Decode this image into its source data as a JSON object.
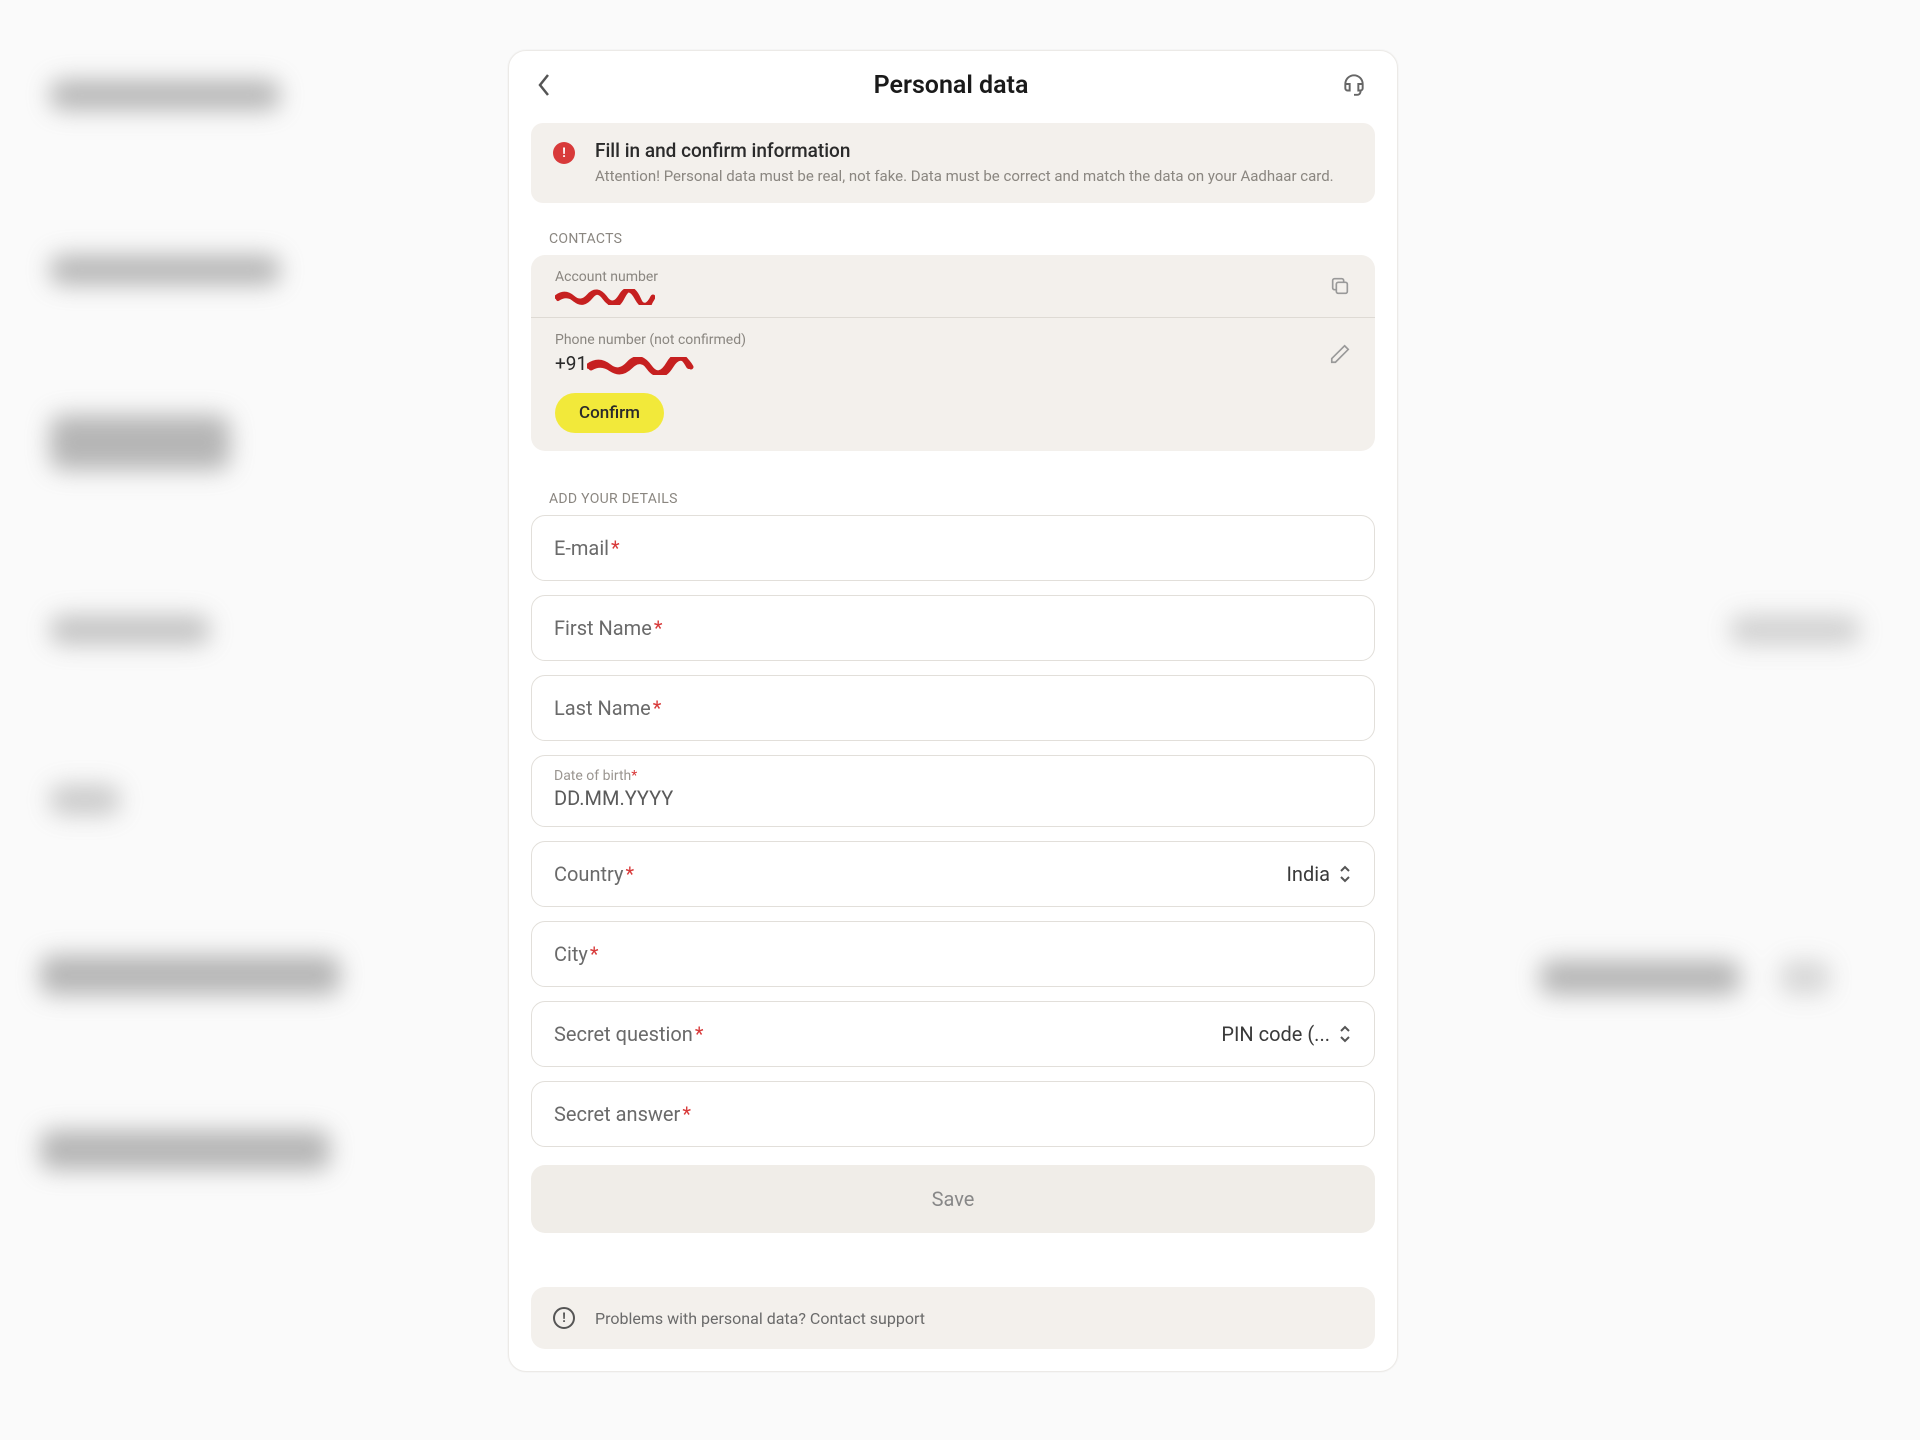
{
  "header": {
    "title": "Personal data"
  },
  "alert": {
    "title": "Fill in and confirm information",
    "message": "Attention! Personal data must be real, not fake. Data must be correct and match the data on your Aadhaar card."
  },
  "sections": {
    "contacts_label": "CONTACTS",
    "details_label": "ADD YOUR DETAILS"
  },
  "contacts": {
    "account_label": "Account number",
    "phone_label": "Phone number (not confirmed)",
    "phone_prefix": "+91",
    "confirm_label": "Confirm"
  },
  "fields": {
    "email_label": "E-mail",
    "firstname_label": "First Name",
    "lastname_label": "Last Name",
    "dob_label": "Date of birth",
    "dob_placeholder": "DD.MM.YYYY",
    "country_label": "Country",
    "country_value": "India",
    "city_label": "City",
    "secret_q_label": "Secret question",
    "secret_q_value": "PIN code (...",
    "secret_a_label": "Secret answer",
    "save_label": "Save"
  },
  "support": {
    "text": "Problems with personal data? Contact support"
  }
}
